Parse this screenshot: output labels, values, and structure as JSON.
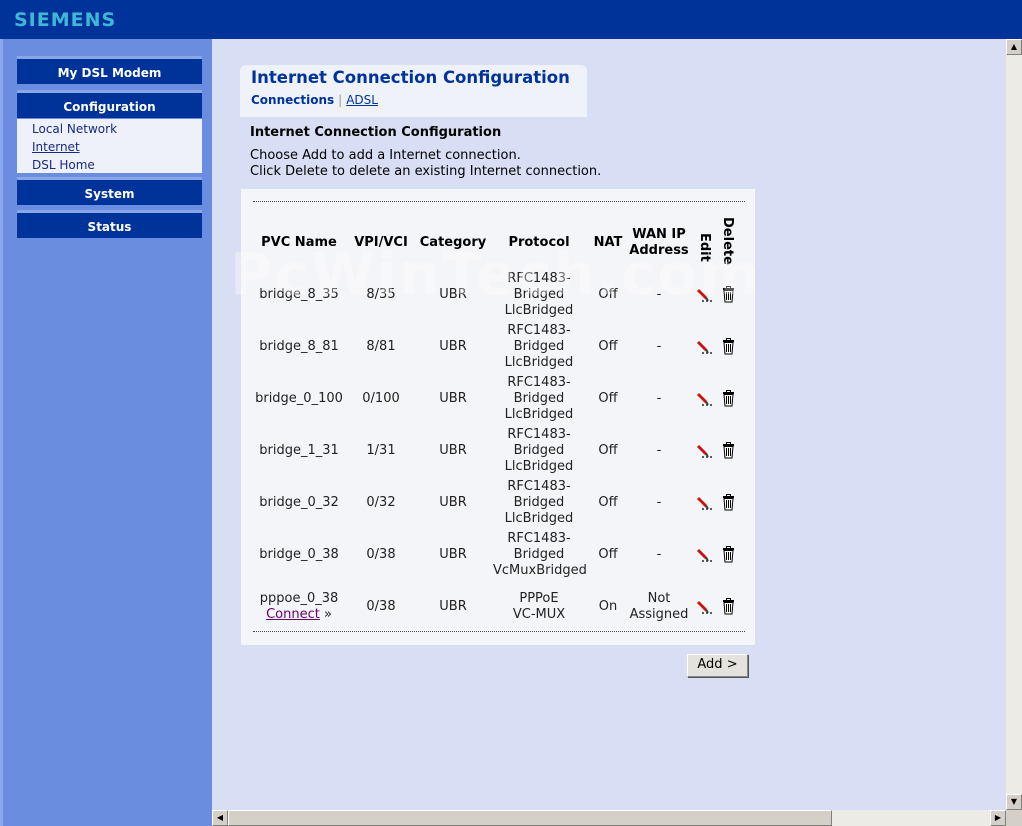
{
  "header": {
    "brand": "SIEMENS"
  },
  "sidebar": {
    "my_dsl_modem": "My DSL Modem",
    "configuration": "Configuration",
    "sub_items": [
      "Local Network",
      "Internet",
      "DSL Home"
    ],
    "system": "System",
    "status": "Status"
  },
  "page": {
    "title": "Internet Connection Configuration",
    "crumb_current": "Connections",
    "crumb_sep": "|",
    "crumb_link": "ADSL",
    "section_heading": "Internet Connection Configuration",
    "desc_line1": "Choose Add to add a Internet connection.",
    "desc_line2": "Click Delete to delete an existing Internet connection."
  },
  "table": {
    "headers": {
      "pvc_name": "PVC Name",
      "vpi_vci": "VPI/VCI",
      "category": "Category",
      "protocol": "Protocol",
      "nat": "NAT",
      "wan_ip": [
        "WAN IP",
        "Address"
      ],
      "edit": "Edit",
      "delete": "Delete"
    },
    "rows": [
      {
        "name": "bridge_8_35",
        "vpivci": "8/35",
        "category": "UBR",
        "protocol": [
          "RFC1483-",
          "Bridged",
          "LlcBridged"
        ],
        "nat": "Off",
        "wan": [
          "-"
        ]
      },
      {
        "name": "bridge_8_81",
        "vpivci": "8/81",
        "category": "UBR",
        "protocol": [
          "RFC1483-",
          "Bridged",
          "LlcBridged"
        ],
        "nat": "Off",
        "wan": [
          "-"
        ]
      },
      {
        "name": "bridge_0_100",
        "vpivci": "0/100",
        "category": "UBR",
        "protocol": [
          "RFC1483-",
          "Bridged",
          "LlcBridged"
        ],
        "nat": "Off",
        "wan": [
          "-"
        ]
      },
      {
        "name": "bridge_1_31",
        "vpivci": "1/31",
        "category": "UBR",
        "protocol": [
          "RFC1483-",
          "Bridged",
          "LlcBridged"
        ],
        "nat": "Off",
        "wan": [
          "-"
        ]
      },
      {
        "name": "bridge_0_32",
        "vpivci": "0/32",
        "category": "UBR",
        "protocol": [
          "RFC1483-",
          "Bridged",
          "LlcBridged"
        ],
        "nat": "Off",
        "wan": [
          "-"
        ]
      },
      {
        "name": "bridge_0_38",
        "vpivci": "0/38",
        "category": "UBR",
        "protocol": [
          "RFC1483-",
          "Bridged",
          "VcMuxBridged"
        ],
        "nat": "Off",
        "wan": [
          "-"
        ]
      },
      {
        "name": "pppoe_0_38",
        "link": "Connect",
        "vpivci": "0/38",
        "category": "UBR",
        "protocol": [
          "PPPoE",
          "VC-MUX"
        ],
        "nat": "On",
        "wan": [
          "Not",
          "Assigned"
        ]
      }
    ]
  },
  "add_button": "Add >",
  "watermark": "PcWinTech.com",
  "icons": {
    "edit": "pencil-icon",
    "delete": "trash-icon",
    "connect": "double-chevron-right-icon"
  },
  "colors": {
    "brand_bar": "#003399",
    "logo": "#3fb8d8",
    "sidebar": "#6a8de0",
    "content_bg": "#d8def4"
  }
}
